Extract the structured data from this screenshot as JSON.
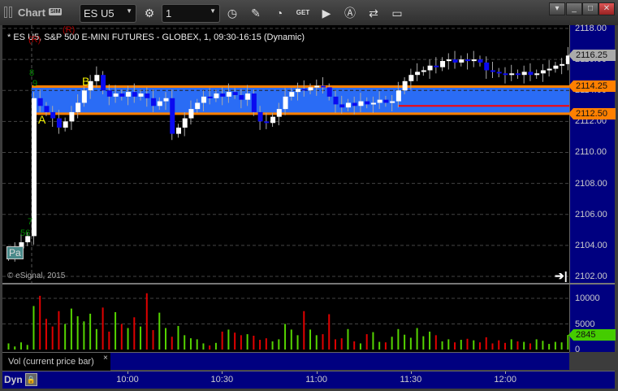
{
  "window": {
    "title": "Chart",
    "sim_badge": "SIM",
    "symbol": "ES U5",
    "interval": "1"
  },
  "chart": {
    "symbol_title": "* ES U5, S&P 500 E-MINI FUTURES - GLOBEX, 1, 09:30-16:15 (Dynamic)",
    "copyright": "© eSignal, 2015",
    "annotations": {
      "a": "A",
      "b": "B",
      "r1": "(R)",
      "r2": "(R)",
      "n8": "8",
      "n9": "9",
      "n7": "7",
      "n56": "56",
      "pa": "Pa"
    },
    "price_labels": [
      "2118.00",
      "2116.00",
      "2114.00",
      "2112.00",
      "2110.00",
      "2108.00",
      "2106.00",
      "2104.00",
      "2102.00"
    ],
    "flags": {
      "last": "2116.25",
      "upper": "2114.25",
      "lower": "2112.50"
    },
    "volume_labels": [
      "10000",
      "5000",
      "0"
    ],
    "volume_flag": "2845",
    "volume_tab": "Vol (current price bar)",
    "volume_tab_close": "×",
    "dyn": "Dyn",
    "time_labels": [
      "10:00",
      "10:30",
      "11:00",
      "11:30",
      "12:00"
    ]
  },
  "colors": {
    "band": "#2a6cf5",
    "band_edge": "#ff8000",
    "down": "#0a0af0",
    "up": "#ffffff",
    "vol_up": "#55d400",
    "vol_down": "#e00000",
    "mid_line": "#ff0000"
  },
  "chart_data": {
    "type": "candlestick",
    "interval": "2 min",
    "start": "09:24",
    "band": [
      2112.5,
      2114.25
    ],
    "closes": [
      2103.5,
      2103.8,
      2104.2,
      2104.6,
      2113.5,
      2113,
      2112.6,
      2112.2,
      2111.6,
      2112,
      2112.6,
      2113.2,
      2114,
      2114.6,
      2115,
      2114,
      2113.6,
      2113.8,
      2113.6,
      2113.9,
      2113.6,
      2113.8,
      2113.5,
      2113,
      2113.3,
      2113.5,
      2111.2,
      2111.6,
      2112.2,
      2112.8,
      2113.2,
      2113.6,
      2113.5,
      2113.8,
      2113.6,
      2113.9,
      2113.7,
      2113.4,
      2113.8,
      2112.6,
      2112,
      2111.9,
      2112.3,
      2112.8,
      2113.6,
      2113.9,
      2114.1,
      2114,
      2114.2,
      2114.3,
      2114.2,
      2113.6,
      2113.1,
      2112.9,
      2113.2,
      2113,
      2113.3,
      2113.1,
      2113.2,
      2113.4,
      2113.2,
      2113.3,
      2114,
      2114.6,
      2115,
      2115.2,
      2115.3,
      2115.6,
      2115.5,
      2115.9,
      2116,
      2115.8,
      2116,
      2115.9,
      2116,
      2115.8,
      2115.3,
      2115.2,
      2115.1,
      2115,
      2115.1,
      2115,
      2115.2,
      2115,
      2115.1,
      2115.3,
      2115.4,
      2115.6,
      2115.7,
      2116.25
    ],
    "volumes": [
      1200,
      600,
      1400,
      900,
      8500,
      10500,
      6000,
      4500,
      7500,
      5000,
      8000,
      6500,
      5500,
      7000,
      4000,
      8200,
      3500,
      7300,
      5000,
      4200,
      6300,
      4500,
      11000,
      3800,
      7200,
      4200,
      2500,
      4600,
      2800,
      2200,
      2000,
      1200,
      800,
      1300,
      3500,
      3900,
      3300,
      2800,
      3000,
      2700,
      1900,
      2200,
      1600,
      2000,
      5000,
      3900,
      2800,
      7500,
      3900,
      2800,
      3000,
      6900,
      2000,
      2200,
      4000,
      1600,
      1200,
      3000,
      3400,
      1500,
      1400,
      2500,
      4000,
      2900,
      2300,
      4200,
      2600,
      3500,
      2800,
      1600,
      2000,
      1400,
      1900,
      2100,
      1800,
      1400,
      2400,
      1200,
      1800,
      1300,
      2000,
      1600,
      1500,
      1200,
      2000,
      1700,
      1100,
      1500,
      1400,
      2845
    ],
    "price_range": [
      2102,
      2118
    ],
    "volume_range": [
      0,
      10000
    ]
  }
}
